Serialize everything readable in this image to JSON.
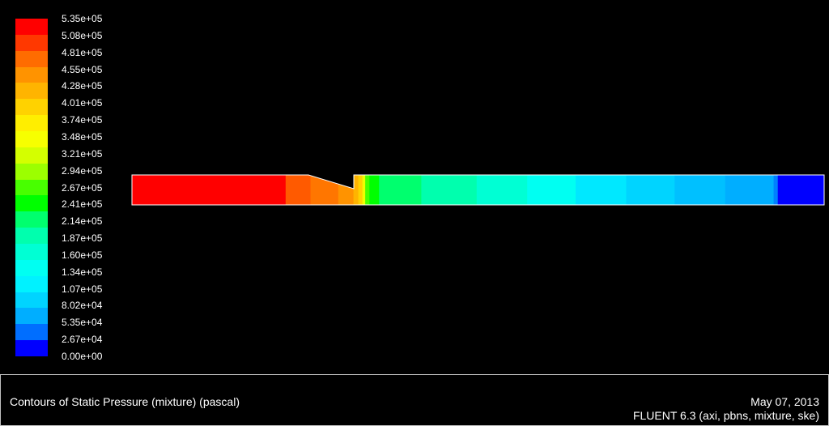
{
  "colorbar": {
    "labels": [
      "5.35e+05",
      "5.08e+05",
      "4.81e+05",
      "4.55e+05",
      "4.28e+05",
      "4.01e+05",
      "3.74e+05",
      "3.48e+05",
      "3.21e+05",
      "2.94e+05",
      "2.67e+05",
      "2.41e+05",
      "2.14e+05",
      "1.87e+05",
      "1.60e+05",
      "1.34e+05",
      "1.07e+05",
      "8.02e+04",
      "5.35e+04",
      "2.67e+04",
      "0.00e+00"
    ],
    "colors": [
      "#ff0000",
      "#ff3800",
      "#ff6c00",
      "#ff9300",
      "#ffb400",
      "#ffd200",
      "#ffee00",
      "#f7ff00",
      "#d4ff00",
      "#9cff00",
      "#48ff00",
      "#00ff00",
      "#00ff6e",
      "#00ffae",
      "#00ffd4",
      "#00fff2",
      "#00f2ff",
      "#00d4ff",
      "#00aeff",
      "#006eff",
      "#0000ff"
    ]
  },
  "domain": {
    "bands": [
      {
        "x0": 0.0,
        "x1": 0.222,
        "color": "#ff0000"
      },
      {
        "x0": 0.222,
        "x1": 0.258,
        "color": "#ff5a00"
      },
      {
        "x0": 0.258,
        "x1": 0.298,
        "color": "#ff7600"
      },
      {
        "x0": 0.298,
        "x1": 0.32,
        "color": "#ff9300"
      },
      {
        "x0": 0.32,
        "x1": 0.327,
        "color": "#ffb400"
      },
      {
        "x0": 0.327,
        "x1": 0.333,
        "color": "#ffd200"
      },
      {
        "x0": 0.333,
        "x1": 0.337,
        "color": "#eeff00"
      },
      {
        "x0": 0.337,
        "x1": 0.343,
        "color": "#48ff00"
      },
      {
        "x0": 0.343,
        "x1": 0.357,
        "color": "#00ff00"
      },
      {
        "x0": 0.357,
        "x1": 0.418,
        "color": "#00ff6e"
      },
      {
        "x0": 0.418,
        "x1": 0.498,
        "color": "#00ffae"
      },
      {
        "x0": 0.498,
        "x1": 0.571,
        "color": "#00ffd4"
      },
      {
        "x0": 0.571,
        "x1": 0.641,
        "color": "#00fff2"
      },
      {
        "x0": 0.641,
        "x1": 0.714,
        "color": "#00e8ff"
      },
      {
        "x0": 0.714,
        "x1": 0.784,
        "color": "#00d4ff"
      },
      {
        "x0": 0.784,
        "x1": 0.857,
        "color": "#00c0ff"
      },
      {
        "x0": 0.857,
        "x1": 0.927,
        "color": "#00aeff"
      },
      {
        "x0": 0.927,
        "x1": 0.933,
        "color": "#0080ff"
      },
      {
        "x0": 0.933,
        "x1": 1.0,
        "color": "#0000ff"
      }
    ]
  },
  "footer": {
    "caption": "Contours of Static Pressure (mixture)  (pascal)",
    "date": "May 07, 2013",
    "solver": "FLUENT 6.3 (axi, pbns, mixture, ske)"
  }
}
